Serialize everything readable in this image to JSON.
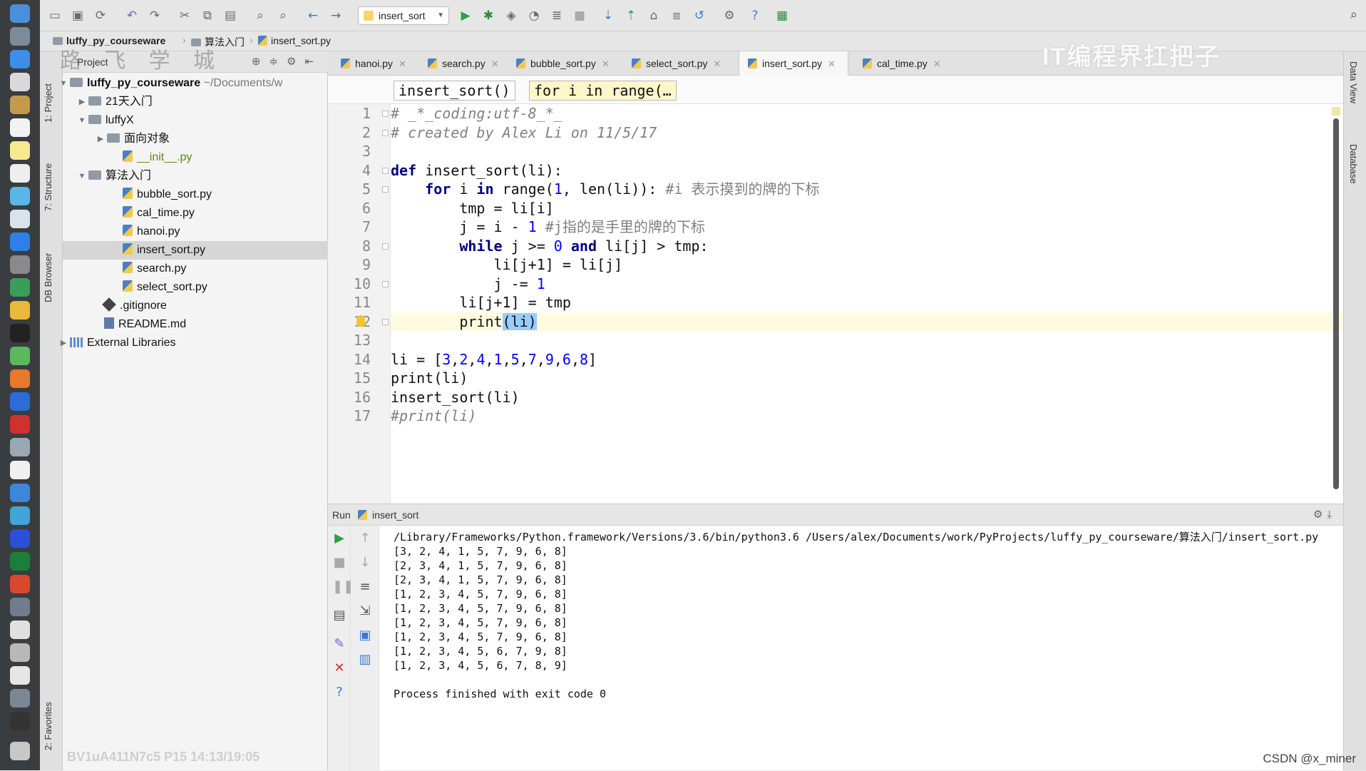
{
  "toolbar": {
    "run_config": "insert_sort"
  },
  "breadcrumb": {
    "items": [
      "luffy_py_courseware",
      "算法入门",
      "insert_sort.py"
    ]
  },
  "watermark": {
    "top_left": "路 飞 学 城",
    "top_right": "IT编程界扛把子",
    "bottom_left": "BV1uA411N7c5 P15 14:13/19:05",
    "bottom_right": "CSDN @x_miner"
  },
  "left_stripe": {
    "tabs": [
      "1: Project",
      "7: Structure",
      "DB Browser",
      "2: Favorites"
    ]
  },
  "right_stripe": {
    "tabs": [
      "Data View",
      "Database"
    ]
  },
  "project": {
    "title": "Project",
    "root_name": "luffy_py_courseware",
    "root_path": "~/Documents/w",
    "nodes": [
      {
        "label": "21天入门"
      },
      {
        "label": "luffyX"
      },
      {
        "label": "面向对象"
      },
      {
        "label": "__init__.py"
      },
      {
        "label": "算法入门"
      },
      {
        "label": "bubble_sort.py"
      },
      {
        "label": "cal_time.py"
      },
      {
        "label": "hanoi.py"
      },
      {
        "label": "insert_sort.py"
      },
      {
        "label": "search.py"
      },
      {
        "label": "select_sort.py"
      },
      {
        "label": ".gitignore"
      },
      {
        "label": "README.md"
      },
      {
        "label": "External Libraries"
      }
    ]
  },
  "tabs": [
    {
      "label": "hanoi.py"
    },
    {
      "label": "search.py"
    },
    {
      "label": "bubble_sort.py"
    },
    {
      "label": "select_sort.py"
    },
    {
      "label": "insert_sort.py",
      "active": true
    },
    {
      "label": "cal_time.py"
    }
  ],
  "editor": {
    "crumbs": [
      "insert_sort()",
      "for i in range(…"
    ],
    "line_numbers": [
      "1",
      "2",
      "3",
      "4",
      "5",
      "6",
      "7",
      "8",
      "9",
      "10",
      "11",
      "12",
      "13",
      "14",
      "15",
      "16",
      "17"
    ],
    "code": {
      "l1": "# _*_coding:utf-8_*_",
      "l2": "# created by Alex Li on 11/5/17",
      "l4_kw": "def",
      "l4_rest": " insert_sort(li):",
      "l5_kw1": "for",
      "l5_a": " i ",
      "l5_kw2": "in",
      "l5_b": " range(",
      "l5_n1": "1",
      "l5_c": ", len(li)): ",
      "l5_cmt": "#i 表示摸到的牌的下标",
      "l6": "tmp = li[i]",
      "l7_a": "j = i - ",
      "l7_n": "1",
      "l7_cmt": " #j指的是手里的牌的下标",
      "l8_kw1": "while",
      "l8_a": " j >= ",
      "l8_n": "0",
      "l8_kw2": "and",
      "l8_b": " li[j] > tmp:",
      "l9": "li[j+1] = li[j]",
      "l10_a": "j -= ",
      "l10_n": "1",
      "l11": "li[j+1] = tmp",
      "l12_a": "print",
      "l12_b": "(li",
      "l12_c": ")",
      "l14_a": "li = [",
      "l14_nums": [
        "3",
        "2",
        "4",
        "1",
        "5",
        "7",
        "9",
        "6",
        "8"
      ],
      "l14_b": "]",
      "l15": "print(li)",
      "l16": "insert_sort(li)",
      "l17": "#print(li)"
    }
  },
  "run": {
    "label": "Run",
    "name": "insert_sort",
    "command": "/Library/Frameworks/Python.framework/Versions/3.6/bin/python3.6 /Users/alex/Documents/work/PyProjects/luffy_py_courseware/算法入门/insert_sort.py",
    "output": [
      "[3, 2, 4, 1, 5, 7, 9, 6, 8]",
      "[2, 3, 4, 1, 5, 7, 9, 6, 8]",
      "[2, 3, 4, 1, 5, 7, 9, 6, 8]",
      "[1, 2, 3, 4, 5, 7, 9, 6, 8]",
      "[1, 2, 3, 4, 5, 7, 9, 6, 8]",
      "[1, 2, 3, 4, 5, 7, 9, 6, 8]",
      "[1, 2, 3, 4, 5, 7, 9, 6, 8]",
      "[1, 2, 3, 4, 5, 6, 7, 9, 8]",
      "[1, 2, 3, 4, 5, 6, 7, 8, 9]"
    ],
    "finish": "Process finished with exit code 0"
  },
  "colors": {
    "keyword": "#000080",
    "number": "#0000ff",
    "comment": "#808080",
    "current_line": "#fffbe1"
  }
}
